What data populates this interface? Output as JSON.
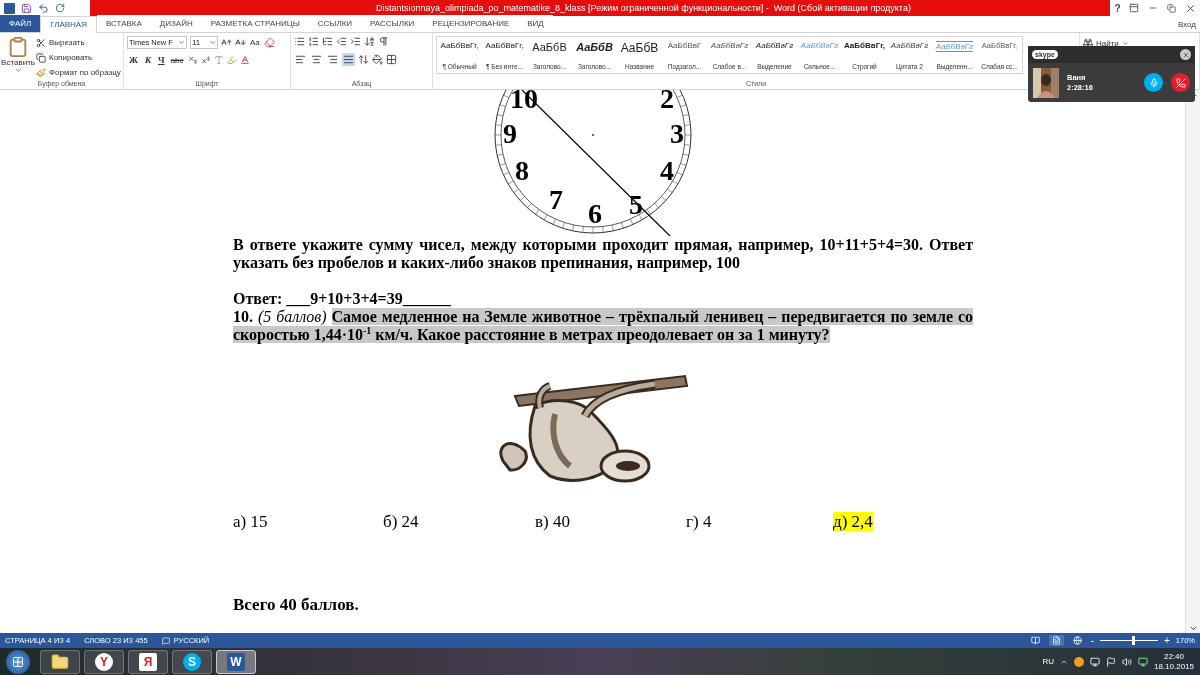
{
  "title_bar": {
    "title": "Distantsionnaya_olimpiada_po_matematike_8_klass [Режим ограниченной функциональности] -  Word (Сбой активации продукта)",
    "help": "?"
  },
  "tabs": [
    {
      "label": "ФАЙЛ",
      "kind": "file",
      "selected": false
    },
    {
      "label": "ГЛАВНАЯ",
      "kind": "tab",
      "selected": true
    },
    {
      "label": "ВСТАВКА",
      "kind": "tab",
      "selected": false
    },
    {
      "label": "ДИЗАЙН",
      "kind": "tab",
      "selected": false
    },
    {
      "label": "РАЗМЕТКА СТРАНИЦЫ",
      "kind": "tab",
      "selected": false
    },
    {
      "label": "ССЫЛКИ",
      "kind": "tab",
      "selected": false
    },
    {
      "label": "РАССЫЛКИ",
      "kind": "tab",
      "selected": false
    },
    {
      "label": "РЕЦЕНЗИРОВАНИЕ",
      "kind": "tab",
      "selected": false
    },
    {
      "label": "ВИД",
      "kind": "tab",
      "selected": false
    }
  ],
  "sign_in": "Вход",
  "clipboard": {
    "paste": "Вставить",
    "group_label": "Буфер обмена",
    "actions": [
      {
        "kind": "cut",
        "label": "Вырезать"
      },
      {
        "kind": "copy",
        "label": "Копировать"
      },
      {
        "kind": "format",
        "label": "Формат по образцу"
      }
    ]
  },
  "font": {
    "name": "Times New F",
    "size": "11",
    "change_case": "Aa",
    "format_buttons": [
      "Ж",
      "К",
      "Ч"
    ],
    "strike": "abc",
    "group_label": "Шрифт"
  },
  "paragraph": {
    "group_label": "Абзац",
    "align": [
      {
        "kind": "left",
        "selected": false
      },
      {
        "kind": "center",
        "selected": false
      },
      {
        "kind": "right",
        "selected": false
      },
      {
        "kind": "justify",
        "selected": true
      }
    ]
  },
  "styles": {
    "group_label": "Стили",
    "items": [
      {
        "kind": "normal",
        "preview": "АаБбВвГг,",
        "label": "¶ Обычный"
      },
      {
        "kind": "normal",
        "preview": "АаБбВвГг,",
        "label": "¶ Без инте..."
      },
      {
        "kind": "heading",
        "preview": "АаБбВ",
        "label": "Заголово..."
      },
      {
        "kind": "heading_italic",
        "preview": "АаБбВ",
        "label": "Заголово..."
      },
      {
        "kind": "title",
        "preview": "АаБбВ",
        "label": "Название"
      },
      {
        "kind": "subtitle",
        "preview": "АаБбВвГ",
        "label": "Подзагол..."
      },
      {
        "kind": "subtle",
        "preview": "АаБбВвГг",
        "label": "Слабое в..."
      },
      {
        "kind": "emphasis",
        "preview": "АаБбВвГг",
        "label": "Выделение"
      },
      {
        "kind": "intense",
        "preview": "АаБбВвГг",
        "label": "Сильное..."
      },
      {
        "kind": "strong",
        "preview": "АаБбВвГг,",
        "label": "Строгий"
      },
      {
        "kind": "quote",
        "preview": "АаБбВвГг",
        "label": "Цитата 2"
      },
      {
        "kind": "intense_quote",
        "preview": "АаБбВвГг",
        "label": "Выделенн..."
      },
      {
        "kind": "reference",
        "preview": "АаБбВвГг,",
        "label": "Слабая сс..."
      }
    ]
  },
  "editing": {
    "find": "Найти"
  },
  "skype": {
    "logo": "skype",
    "caller": "Ваня",
    "duration": "2:28:16"
  },
  "document": {
    "clock": {
      "numerals": [
        "10",
        "2",
        "9",
        "3",
        "8",
        "4",
        "7",
        "6",
        "5"
      ]
    },
    "instruction": "В ответе укажите сумму чисел, между которыми проходит прямая, например, 10+11+5+4=30. Ответ указать без пробелов и каких-либо знаков препинания, например, 100",
    "answer": "Ответ: ___9+10+3+4=39______",
    "question": {
      "label": "**10.** *(5 баллов)*",
      "text": "Самое медленное на Земле животное – трёхпалый ленивец – передвигается по земле со скоростью 1,44·10$^{-1}$ км/ч. Какое расстояние в метрах преодолевает он за 1 минуту?",
      "highlighted": true
    },
    "options": [
      {
        "label": "а) 15",
        "highlighted": false
      },
      {
        "label": "б) 24",
        "highlighted": false
      },
      {
        "label": "в) 40",
        "highlighted": false
      },
      {
        "label": "г) 4",
        "highlighted": false
      },
      {
        "label": "д) 2,4",
        "highlighted": true
      }
    ],
    "total": "Всего 40 баллов."
  },
  "status_bar": {
    "page": "СТРАНИЦА 4 ИЗ 4",
    "words": "СЛОВО 23 ИЗ 455",
    "language": "РУССКИЙ",
    "views": [
      {
        "kind": "read",
        "selected": false
      },
      {
        "kind": "print",
        "selected": true
      },
      {
        "kind": "web",
        "selected": false
      }
    ],
    "zoom_out": "-",
    "zoom_in": "+",
    "zoom": {
      "level": 0.55
    },
    "zoom_label": "170%"
  },
  "taskbar": {
    "apps": [
      {
        "kind": "explorer",
        "selected": false
      },
      {
        "kind": "browser",
        "label": "Y",
        "selected": false
      },
      {
        "kind": "yandex",
        "label": "Я",
        "selected": false
      },
      {
        "kind": "skype",
        "label": "S",
        "selected": false
      },
      {
        "kind": "word",
        "label": "W",
        "selected": true
      }
    ],
    "language": "RU",
    "time": "22:40",
    "date": "18.10.2015"
  }
}
